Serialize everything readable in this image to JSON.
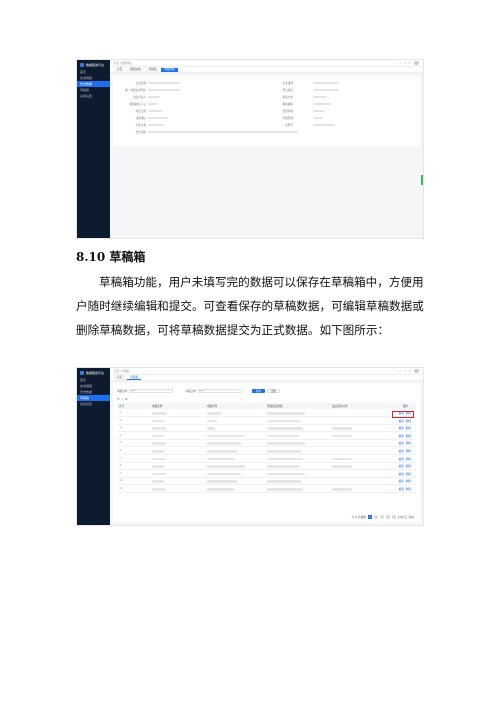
{
  "section": {
    "number": "8.10",
    "title": "草稿箱",
    "paragraphs": [
      "草稿箱功能，用户未填写完的数据可以保存在草稿箱中，方便用",
      "户随时继续编辑和提交。可查看保存的草稿数据，可编辑草稿数据或",
      "删除草稿数据，可将草稿数据提交为正式数据。如下图所示："
    ]
  },
  "screenshot1": {
    "app_title": "数据报送平台",
    "sidebar": [
      "首页",
      "在线填报",
      "历史数据",
      "草稿箱",
      "系统设置"
    ],
    "active_index": 2,
    "breadcrumb": "首页 / 数据填报",
    "tabs": [
      "首页",
      "数据填报",
      "草稿箱",
      "填报详情"
    ],
    "active_tab": 3,
    "form_left_labels": [
      "企业名称",
      "统一社会信用代码",
      "法定代表人",
      "注册资本(万元)",
      "成立日期",
      "注册地址",
      "行业分类",
      "经营范围"
    ],
    "form_right_labels": [
      "企业类型",
      "登记机关",
      "联系方式",
      "邮政编码",
      "经营状态",
      "所属区域",
      "注册号"
    ]
  },
  "screenshot2": {
    "app_title": "数据报送平台",
    "sidebar": [
      "首页",
      "在线填报",
      "历史数据",
      "草稿箱",
      "系统设置"
    ],
    "active_index": 3,
    "breadcrumb": "首页 / 草稿箱",
    "tabs": [
      "首页",
      "草稿箱"
    ],
    "active_tab": 1,
    "filters": {
      "label1": "填报名称",
      "placeholder1": "请输入",
      "label2": "填报日期",
      "placeholder2": "请选择",
      "search": "查询",
      "reset": "重置"
    },
    "columns": [
      "序号",
      "填报名称",
      "填报单位",
      "所属报送模板",
      "最后保存时间",
      "操作"
    ],
    "row_count": 11,
    "op_edit": "编辑",
    "op_delete": "删除",
    "pager": {
      "total": "共 11 条数据",
      "pages": [
        "1",
        "2",
        "3",
        "4",
        "5"
      ],
      "per_page": "10条/页",
      "goto": "前往"
    }
  }
}
